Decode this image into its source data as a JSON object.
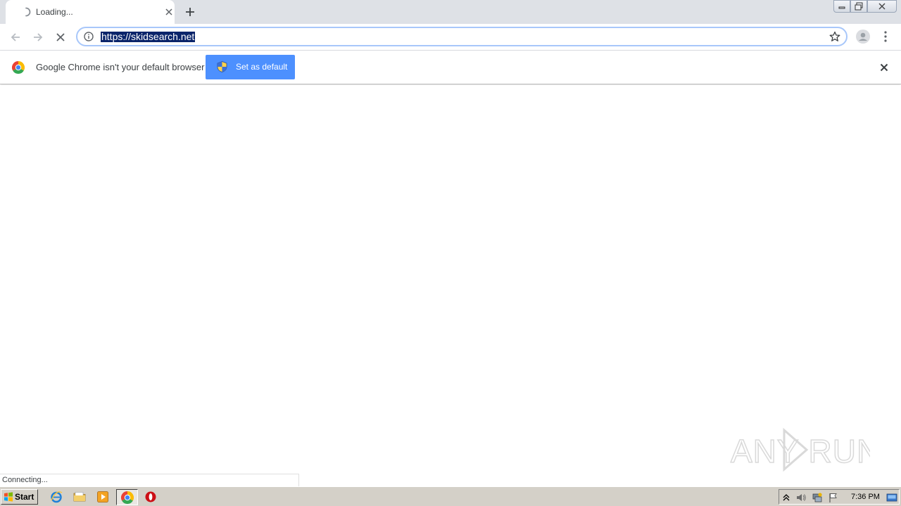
{
  "browser": {
    "tab": {
      "title": "Loading..."
    },
    "omnibox": {
      "url": "https://skidsearch.net"
    },
    "infobar": {
      "message": "Google Chrome isn't your default browser",
      "button_label": "Set as default"
    },
    "status_text": "Connecting..."
  },
  "watermark": {
    "text": "ANY RUN"
  },
  "taskbar": {
    "start_label": "Start",
    "clock": "7:36 PM"
  },
  "colors": {
    "tabstrip_bg": "#dee1e6",
    "accent_blue": "#4d90fe",
    "url_selection": "#0a246a",
    "taskbar_bg": "#d4d0c8"
  }
}
